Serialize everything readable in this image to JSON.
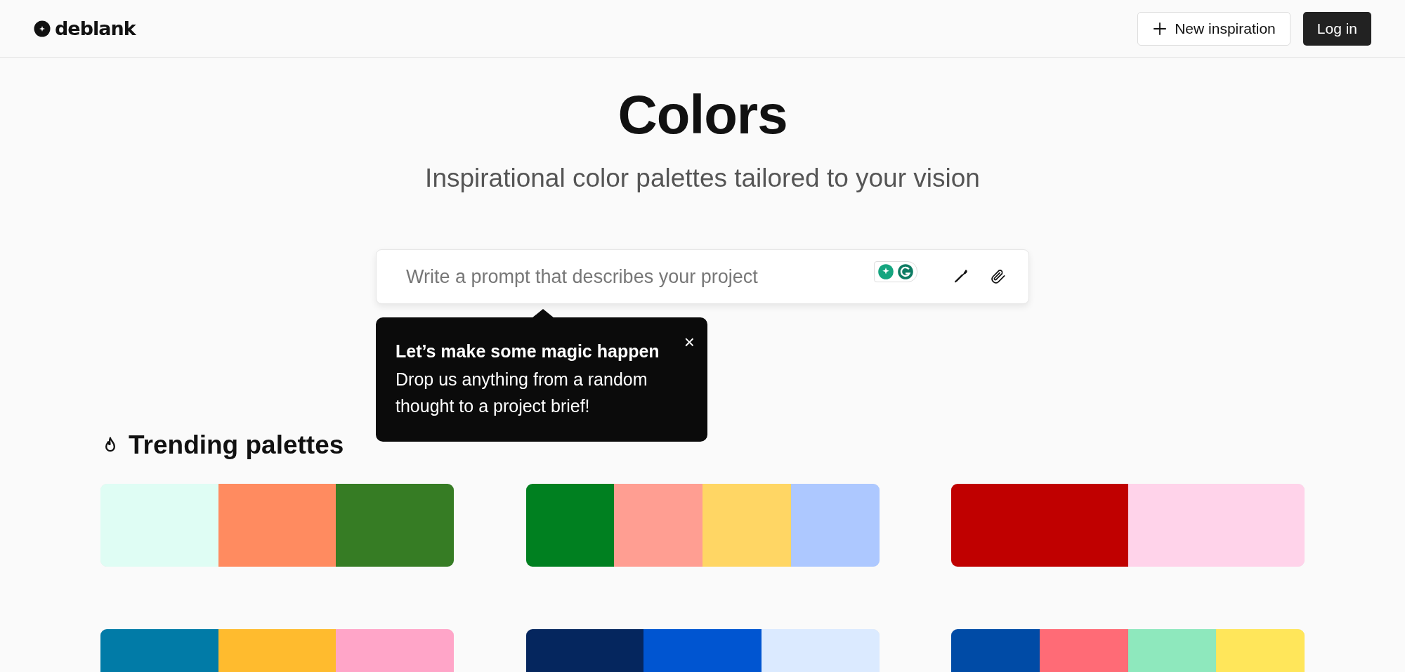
{
  "header": {
    "logo": "deblank",
    "new_button": "New inspiration",
    "login_button": "Log in"
  },
  "hero": {
    "title": "Colors",
    "subtitle": "Inspirational color palettes tailored to your vision"
  },
  "search": {
    "placeholder": "Write a prompt that describes your project"
  },
  "tooltip": {
    "title": "Let’s make some magic happen",
    "body": "Drop us anything from a random thought to a project brief!",
    "close": "×"
  },
  "trending": {
    "title": "Trending palettes",
    "palettes": [
      {
        "swatches": [
          {
            "color": "#dffdf4"
          },
          {
            "color": "#ff8b60"
          },
          {
            "color": "#367c24"
          }
        ]
      },
      {
        "swatches": [
          {
            "color": "#008020"
          },
          {
            "color": "#ff9e92"
          },
          {
            "color": "#ffd664"
          },
          {
            "color": "#adc8ff"
          }
        ]
      },
      {
        "swatches": [
          {
            "color": "#c00000"
          },
          {
            "color": "#ffd3ea"
          }
        ]
      },
      {
        "swatches": [
          {
            "color": "#017ba7"
          },
          {
            "color": "#ffbb2e"
          },
          {
            "color": "#ffa5c8"
          }
        ]
      },
      {
        "swatches": [
          {
            "color": "#05265e"
          },
          {
            "color": "#0055d1"
          },
          {
            "color": "#dbeaff"
          }
        ]
      },
      {
        "swatches": [
          {
            "color": "#004ba6"
          },
          {
            "color": "#ff6b76"
          },
          {
            "color": "#8ee8bd"
          },
          {
            "color": "#ffe65a"
          }
        ]
      }
    ]
  }
}
